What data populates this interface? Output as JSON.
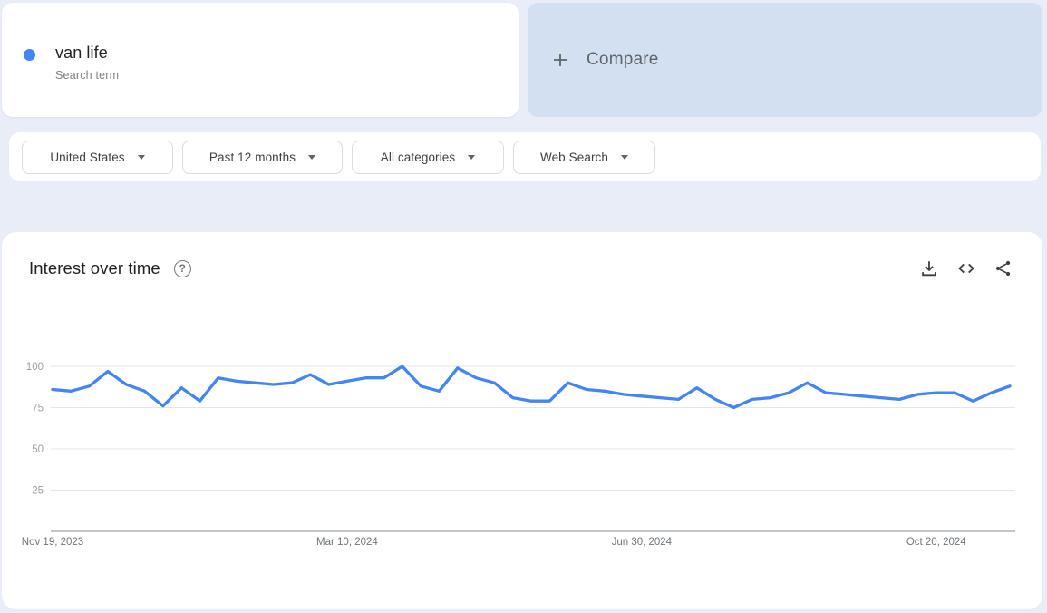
{
  "page": {
    "background": "#e8edf7"
  },
  "term_card": {
    "term": "van life",
    "type_label": "Search term",
    "dot_color": "#4285f4",
    "dot_icon": "series-color-dot"
  },
  "compare_card": {
    "label": "Compare",
    "plus_icon": "plus-icon",
    "background": "#d2e0f2"
  },
  "filters": [
    {
      "label": "United States"
    },
    {
      "label": "Past 12 months"
    },
    {
      "label": "All categories"
    },
    {
      "label": "Web Search"
    }
  ],
  "chart_card": {
    "title": "Interest over time",
    "help_icon": "question-mark-icon",
    "action_icons": [
      "download-icon",
      "embed-code-icon",
      "share-icon"
    ]
  },
  "chart_data": {
    "type": "line",
    "title": "Interest over time",
    "ylim": [
      0,
      100
    ],
    "yticks": [
      100,
      75,
      50,
      25
    ],
    "grid": "horizontal",
    "legend_position": "none",
    "line_color": "#4285f4",
    "x_tick_labels": [
      {
        "label": "Nov 19, 2023",
        "week_index": 0
      },
      {
        "label": "Mar 10, 2024",
        "week_index": 16
      },
      {
        "label": "Jun 30, 2024",
        "week_index": 32
      },
      {
        "label": "Oct 20, 2024",
        "week_index": 48
      }
    ],
    "series": [
      {
        "name": "van life",
        "color": "#4285f4",
        "values": [
          86,
          85,
          88,
          97,
          89,
          85,
          76,
          87,
          79,
          93,
          91,
          90,
          89,
          90,
          95,
          89,
          91,
          93,
          93,
          100,
          88,
          85,
          99,
          93,
          90,
          81,
          79,
          79,
          90,
          86,
          85,
          83,
          82,
          81,
          80,
          87,
          80,
          75,
          80,
          81,
          84,
          90,
          84,
          83,
          82,
          81,
          80,
          83,
          84,
          84,
          79,
          84,
          88
        ]
      }
    ]
  }
}
